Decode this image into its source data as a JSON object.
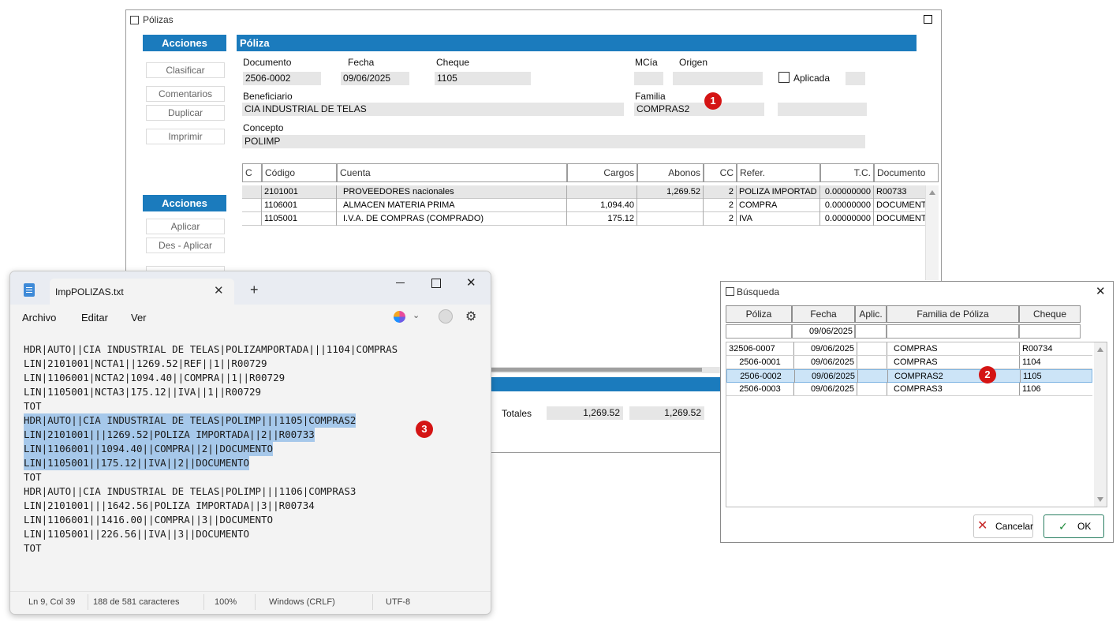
{
  "polizas_window": {
    "title": "Pólizas",
    "side_header_1": "Acciones",
    "side_buttons_1": [
      "Clasificar",
      "Comentarios",
      "Duplicar",
      "Imprimir"
    ],
    "side_header_2": "Acciones",
    "side_buttons_2": [
      "Aplicar",
      "Des - Aplicar"
    ],
    "section_title": "Póliza",
    "labels": {
      "documento": "Documento",
      "fecha": "Fecha",
      "cheque": "Cheque",
      "mcia": "MCía",
      "origen": "Origen",
      "aplicada": "Aplicada",
      "beneficiario": "Beneficiario",
      "familia": "Familia",
      "concepto": "Concepto"
    },
    "values": {
      "documento": "2506-0002",
      "fecha": "09/06/2025",
      "cheque": "1105",
      "beneficiario": "CIA INDUSTRIAL DE TELAS",
      "familia": "COMPRAS2",
      "concepto": "POLIMP"
    },
    "grid": {
      "headers": [
        "C",
        "Código",
        "Cuenta",
        "Cargos",
        "Abonos",
        "CC",
        "Refer.",
        "T.C.",
        "Documento"
      ],
      "rows": [
        {
          "codigo": "2101001",
          "cuenta": "PROVEEDORES nacionales",
          "cargos": "",
          "abonos": "1,269.52",
          "cc": "2",
          "refer": "POLIZA IMPORTAD",
          "tc": "0.00000000",
          "documento": "R00733"
        },
        {
          "codigo": "1106001",
          "cuenta": "ALMACEN MATERIA PRIMA",
          "cargos": "1,094.40",
          "abonos": "",
          "cc": "2",
          "refer": "COMPRA",
          "tc": "0.00000000",
          "documento": "DOCUMENT"
        },
        {
          "codigo": "1105001",
          "cuenta": "I.V.A. DE COMPRAS (COMPRADO)",
          "cargos": "175.12",
          "abonos": "",
          "cc": "2",
          "refer": "IVA",
          "tc": "0.00000000",
          "documento": "DOCUMENT"
        }
      ]
    },
    "totales_label": "Totales",
    "total_cargos": "1,269.52",
    "total_abonos": "1,269.52"
  },
  "notepad": {
    "tab_title": "ImpPOLIZAS.txt",
    "menu": [
      "Archivo",
      "Editar",
      "Ver"
    ],
    "lines": [
      "HDR|AUTO||CIA INDUSTRIAL DE TELAS|POLIZAMPORTADA|||1104|COMPRAS",
      "LIN|2101001|NCTA1||1269.52|REF||1||R00729",
      "LIN|1106001|NCTA2|1094.40||COMPRA||1||R00729",
      "LIN|1105001|NCTA3|175.12||IVA||1||R00729",
      "TOT",
      "HDR|AUTO||CIA INDUSTRIAL DE TELAS|POLIMP|||1105|COMPRAS2",
      "LIN|2101001|||1269.52|POLIZA IMPORTADA||2||R00733",
      "LIN|1106001||1094.40||COMPRA||2||DOCUMENTO",
      "LIN|1105001||175.12||IVA||2||DOCUMENTO",
      "TOT",
      "HDR|AUTO||CIA INDUSTRIAL DE TELAS|POLIMP|||1106|COMPRAS3",
      "LIN|2101001|||1642.56|POLIZA IMPORTADA||3||R00734",
      "LIN|1106001||1416.00||COMPRA||3||DOCUMENTO",
      "LIN|1105001||226.56||IVA||3||DOCUMENTO",
      "TOT"
    ],
    "status": {
      "position": "Ln 9, Col 39",
      "chars": "188 de 581 caracteres",
      "zoom": "100%",
      "eol": "Windows (CRLF)",
      "encoding": "UTF-8"
    }
  },
  "busqueda": {
    "title": "Búsqueda",
    "headers": [
      "Póliza",
      "Fecha",
      "Aplic.",
      "Familia de Póliza",
      "Cheque"
    ],
    "filter_fecha": "09/06/2025",
    "rows": [
      {
        "poliza": "32506-0007",
        "fecha": "09/06/2025",
        "aplic": "",
        "familia": "COMPRAS",
        "cheque": "R00734"
      },
      {
        "poliza": "2506-0001",
        "fecha": "09/06/2025",
        "aplic": "",
        "familia": "COMPRAS",
        "cheque": "1104"
      },
      {
        "poliza": "2506-0002",
        "fecha": "09/06/2025",
        "aplic": "",
        "familia": "COMPRAS2",
        "cheque": "1105"
      },
      {
        "poliza": "2506-0003",
        "fecha": "09/06/2025",
        "aplic": "",
        "familia": "COMPRAS3",
        "cheque": "1106"
      }
    ],
    "cancel_label": "Cancelar",
    "ok_label": "OK"
  },
  "badges": [
    "1",
    "2",
    "3"
  ],
  "colors": {
    "accent": "#1b7bbd",
    "selection": "#a6c8ea",
    "row_highlight": "#cce4f7",
    "badge": "#d41414"
  }
}
